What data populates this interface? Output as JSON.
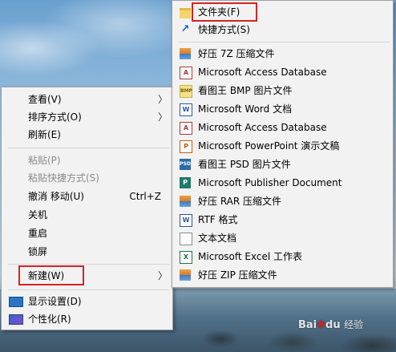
{
  "watermark": {
    "brand": "Bai",
    "du": "du",
    "suffix": "经验"
  },
  "context_menu": {
    "items": [
      {
        "label": "查看(V)",
        "has_submenu": true
      },
      {
        "label": "排序方式(O)",
        "has_submenu": true
      },
      {
        "label": "刷新(E)"
      },
      {
        "label": "粘贴(P)",
        "disabled": true
      },
      {
        "label": "粘贴快捷方式(S)",
        "disabled": true
      },
      {
        "label": "撤消 移动(U)",
        "shortcut": "Ctrl+Z"
      },
      {
        "label": "关机"
      },
      {
        "label": "重启"
      },
      {
        "label": "锁屏"
      },
      {
        "label": "新建(W)",
        "has_submenu": true,
        "highlighted": true
      },
      {
        "label": "显示设置(D)",
        "icon": "display-icon"
      },
      {
        "label": "个性化(R)",
        "icon": "personalize-icon"
      }
    ],
    "submenu_arrow": "〉"
  },
  "new_submenu": {
    "items": [
      {
        "label": "文件夹(F)",
        "icon": "folder-icon",
        "highlighted": true
      },
      {
        "label": "快捷方式(S)",
        "icon": "shortcut-icon"
      },
      {
        "label": "好压 7Z 压缩文件",
        "icon": "archive-icon"
      },
      {
        "label": "Microsoft Access Database",
        "icon": "access-icon"
      },
      {
        "label": "看图王 BMP 图片文件",
        "icon": "bmp-icon"
      },
      {
        "label": "Microsoft Word 文档",
        "icon": "word-icon"
      },
      {
        "label": "Microsoft Access Database",
        "icon": "access-icon"
      },
      {
        "label": "Microsoft PowerPoint 演示文稿",
        "icon": "powerpoint-icon"
      },
      {
        "label": "看图王 PSD 图片文件",
        "icon": "psd-icon"
      },
      {
        "label": "Microsoft Publisher Document",
        "icon": "publisher-icon"
      },
      {
        "label": "好压 RAR 压缩文件",
        "icon": "archive-icon"
      },
      {
        "label": "RTF 格式",
        "icon": "rtf-icon"
      },
      {
        "label": "文本文档",
        "icon": "text-document-icon"
      },
      {
        "label": "Microsoft Excel 工作表",
        "icon": "excel-icon"
      },
      {
        "label": "好压 ZIP 压缩文件",
        "icon": "archive-icon"
      }
    ]
  },
  "colors": {
    "highlight_border": "#d32424",
    "menu_bg": "#f2f2f2",
    "disabled_text": "#8a8a8a"
  }
}
